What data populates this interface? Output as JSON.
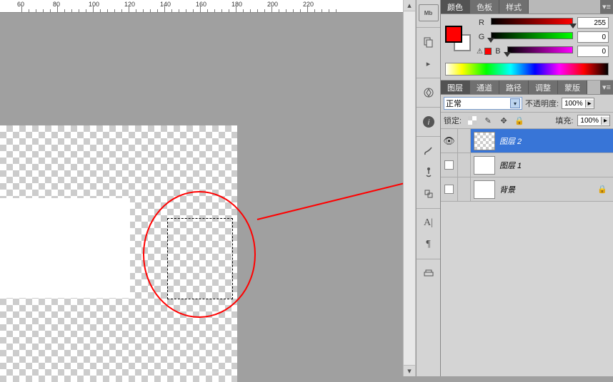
{
  "ruler": {
    "ticks": [
      60,
      80,
      100,
      120,
      140,
      160,
      180,
      200,
      220
    ]
  },
  "color_panel": {
    "tabs": [
      "颜色",
      "色板",
      "样式"
    ],
    "active_tab": 0,
    "foreground": "#ff0000",
    "channels": {
      "R_label": "R",
      "G_label": "G",
      "B_label": "B",
      "R": "255",
      "G": "0",
      "B": "0"
    },
    "warning": "⚠"
  },
  "layers_panel": {
    "tabs": [
      "图层",
      "通道",
      "路径",
      "调整",
      "蒙版"
    ],
    "active_tab": 0,
    "blend_mode": "正常",
    "opacity_label": "不透明度:",
    "opacity_value": "100%",
    "lock_label": "锁定:",
    "fill_label": "填充:",
    "fill_value": "100%",
    "layers": [
      {
        "name": "图层 2",
        "selected": true,
        "trans": true,
        "eye": true,
        "lock": false
      },
      {
        "name": "图层 1",
        "selected": false,
        "trans": false,
        "eye": false,
        "lock": false
      },
      {
        "name": "背景",
        "selected": false,
        "trans": false,
        "eye": false,
        "lock": true
      }
    ]
  }
}
